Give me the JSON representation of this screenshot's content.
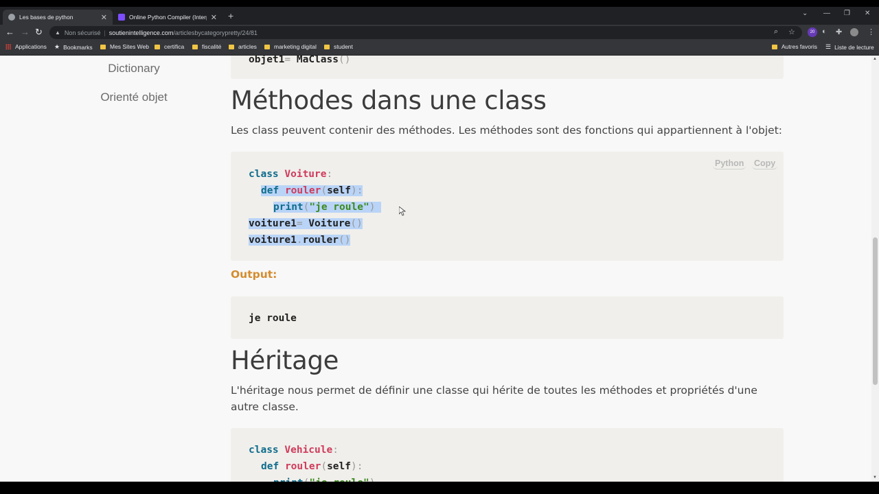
{
  "browser": {
    "tabs": [
      {
        "title": "Les bases de python",
        "active": true
      },
      {
        "title": "Online Python Compiler (Interpre",
        "active": false
      }
    ],
    "address": {
      "security": "Non sécurisé",
      "host": "soutienintelligence.com",
      "path": "/articlesbycategorypretty/24/81"
    },
    "extension_badge": "20",
    "bookmarks": [
      "Applications",
      "Bookmarks",
      "Mes Sites Web",
      "certifica",
      "fiscalité",
      "articles",
      "marketing digital",
      "student"
    ],
    "bookmarks_right": [
      "Autres favoris",
      "Liste de lecture"
    ]
  },
  "sidebar": {
    "items": [
      "Dictionary",
      "Orienté objet"
    ]
  },
  "content": {
    "prev_code_line": "objet1= MaClass()",
    "section1": {
      "heading": "Méthodes dans une class",
      "text": "Les class peuvent contenir des méthodes. Les méthodes sont des fonctions qui appartiennent à l'objet:",
      "lang_label": "Python",
      "copy_label": "Copy"
    },
    "output_label": "Output:",
    "output_text": "je roule",
    "section2": {
      "heading": "Héritage",
      "text": "L'héritage nous permet de définir une classe qui hérite de toutes les méthodes et propriétés d'une autre classe."
    }
  },
  "colors": {
    "keyword": "#0f6c8c",
    "class_name": "#d03a5a",
    "string": "#3c8a1e",
    "output_label": "#d48c2f",
    "selection": "#b9d4f7"
  }
}
